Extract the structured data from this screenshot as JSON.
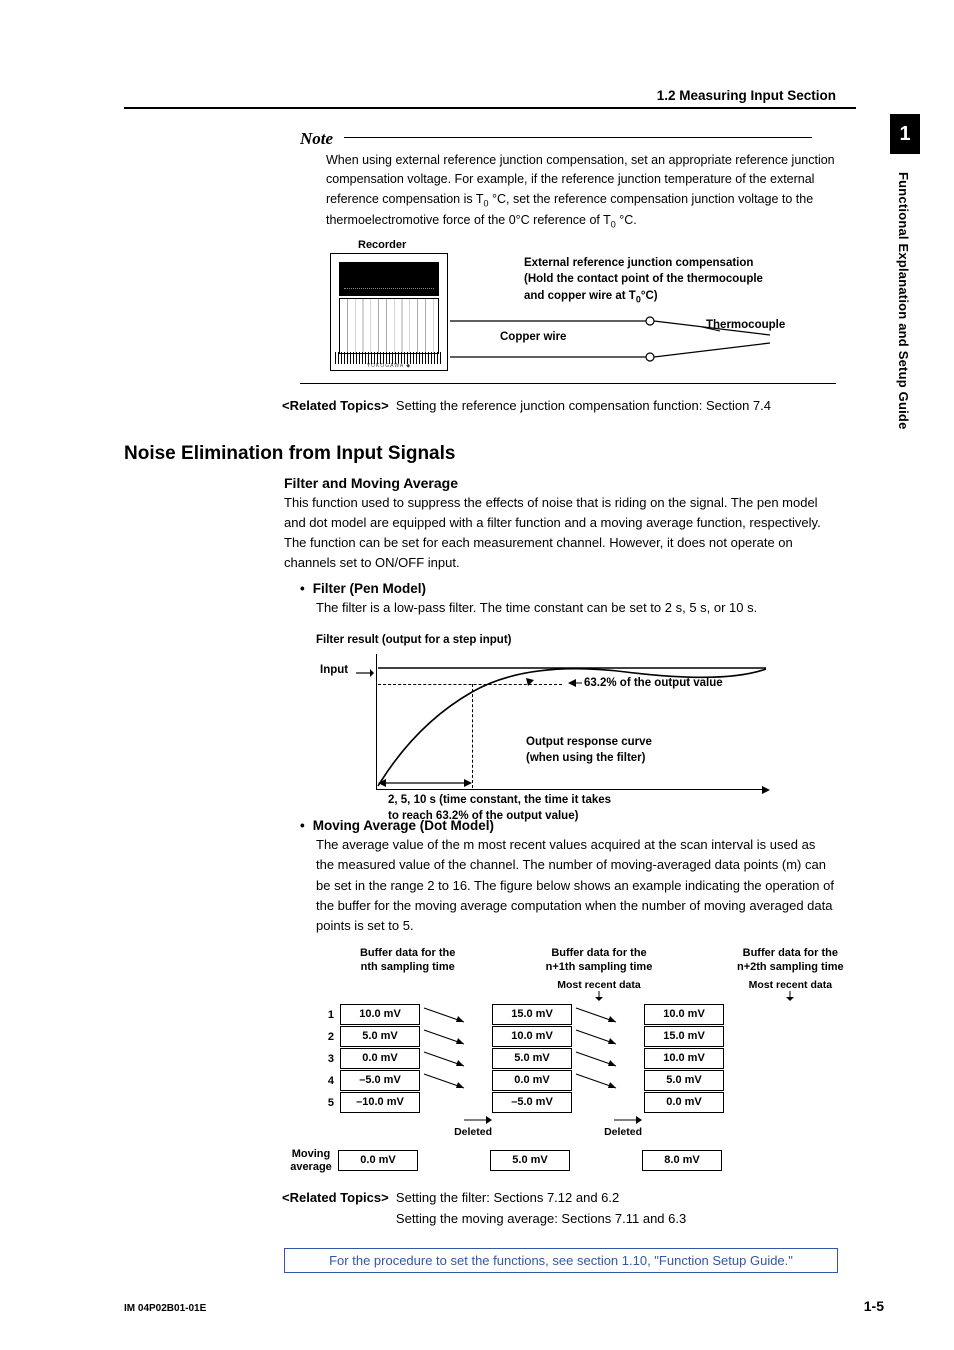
{
  "sidebar": {
    "chapter": "1",
    "title": "Functional Explanation and Setup Guide"
  },
  "breadcrumb": "1.2  Measuring Input Section",
  "note": {
    "heading": "Note",
    "body_pre": "When using external reference junction compensation, set an appropriate reference junction compensation voltage. For example, if the reference junction temperature of the external reference compensation is T",
    "body_mid": " °C, set the reference compensation junction voltage to the thermoelectromotive force of the 0°C reference of T",
    "body_post": " °C.",
    "sub": "0"
  },
  "diag1": {
    "recorder": "Recorder",
    "ext_line1": "External reference junction compensation",
    "ext_line2": "(Hold the contact point of the thermocouple",
    "ext_line3_pre": "and copper wire at T",
    "ext_line3_post": "°C)",
    "copper": "Copper wire",
    "tc": "Thermocouple"
  },
  "related1": {
    "label": "<Related Topics>",
    "text": "Setting the reference junction compensation function: Section 7.4"
  },
  "h2": "Noise Elimination from Input Signals",
  "h3a": "Filter and Moving Average",
  "para_a": "This function used to suppress the effects of noise that is riding on the signal. The pen model and dot model are equipped with a filter function and a moving average function, respectively. The function can be set for each measurement channel. However, it does not operate on channels set to ON/OFF input.",
  "bullet_filter": "Filter (Pen Model)",
  "para_filter": "The filter is a low-pass filter. The time constant can be set to 2 s, 5 s, or 10 s.",
  "filter_caption": "Filter result (output for a step input)",
  "diag2": {
    "input": "Input",
    "percent": "63.2% of the output value",
    "orc1": "Output response curve",
    "orc2": "(when using the filter)",
    "tc1": "2, 5, 10 s (time constant, the time it takes",
    "tc2": "to reach 63.2% of the output value)"
  },
  "bullet_mavg": "Moving Average (Dot Model)",
  "para_mavg": "The average value of the m most recent values acquired at the scan interval is used as the measured value of the channel. The number of moving-averaged data points (m) can be set in the range 2 to 16. The figure below shows an example indicating the operation of the buffer for the moving average computation when the number of moving averaged data points is set to 5.",
  "diag3": {
    "h1a": "Buffer data for the",
    "h1b": "nth sampling time",
    "h2a": "Buffer data for the",
    "h2b": "n+1th sampling time",
    "h3a": "Buffer data for the",
    "h3b": "n+2th sampling time",
    "most_recent": "Most recent data",
    "rows": [
      "1",
      "2",
      "3",
      "4",
      "5"
    ],
    "col1": [
      "10.0 mV",
      "5.0 mV",
      "0.0 mV",
      "–5.0 mV",
      "–10.0 mV"
    ],
    "col2": [
      "15.0 mV",
      "10.0 mV",
      "5.0 mV",
      "0.0 mV",
      "–5.0 mV"
    ],
    "col3": [
      "10.0 mV",
      "15.0 mV",
      "10.0 mV",
      "5.0 mV",
      "0.0 mV"
    ],
    "deleted": "Deleted",
    "mavg_label1": "Moving",
    "mavg_label2": "average",
    "mavg": [
      "0.0 mV",
      "5.0 mV",
      "8.0 mV"
    ]
  },
  "related2": {
    "label": "<Related Topics>",
    "l1": "Setting the filter: Sections 7.12 and 6.2",
    "l2": "Setting the moving average: Sections 7.11 and 6.3"
  },
  "procbox": "For the procedure to set the functions, see section 1.10, \"Function Setup Guide.\"",
  "footer": {
    "docid": "IM 04P02B01-01E",
    "page": "1-5"
  }
}
